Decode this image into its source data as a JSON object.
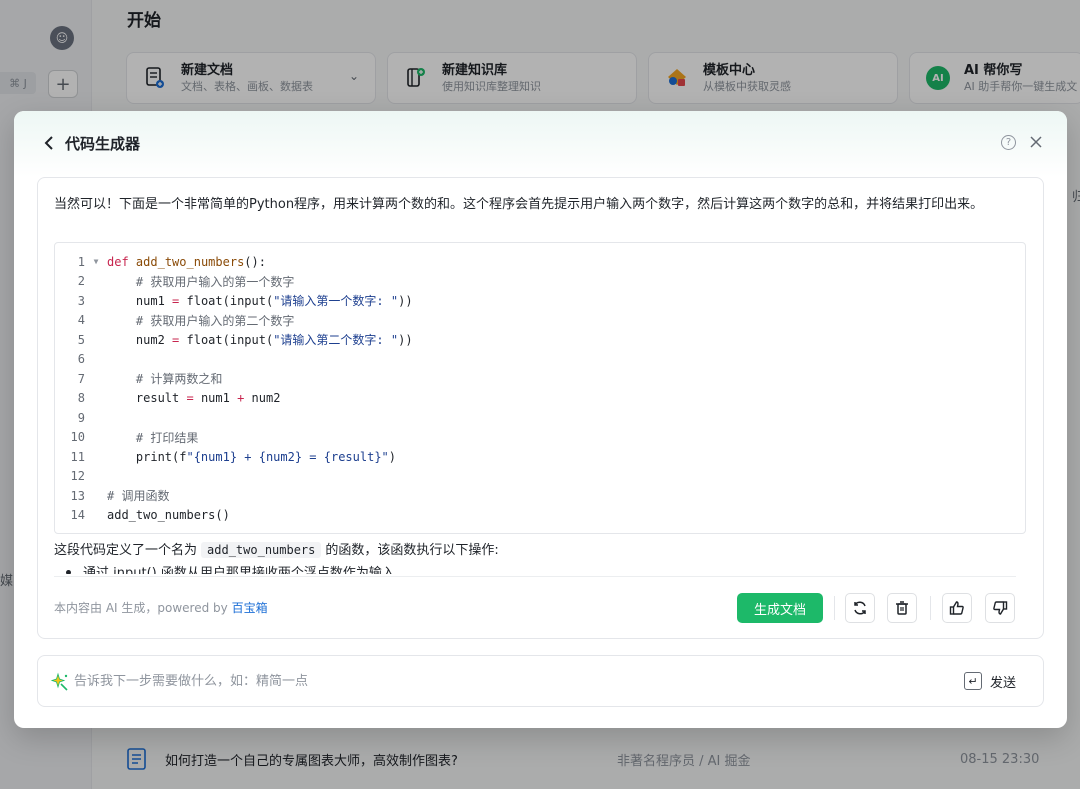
{
  "background": {
    "shortcut_hint": "⌘ J",
    "plus_label": "+",
    "side_fragment": "媒",
    "right_fragment": "归",
    "title": "开始",
    "quick_cards": [
      {
        "title": "新建文档",
        "subtitle": "文档、表格、画板、数据表",
        "icon": "new-doc-icon"
      },
      {
        "title": "新建知识库",
        "subtitle": "使用知识库整理知识",
        "icon": "new-knowledge-base-icon"
      },
      {
        "title": "模板中心",
        "subtitle": "从模板中获取灵感",
        "icon": "template-center-icon"
      },
      {
        "title": "AI 帮你写",
        "subtitle": "AI 助手帮你一键生成文",
        "icon": "ai-write-icon",
        "badge": "AI"
      }
    ],
    "doc_row": {
      "title": "如何打造一个自己的专属图表大师，高效制作图表?",
      "author": "非著名程序员 / AI 掘金",
      "time": "08-15 23:30"
    }
  },
  "modal": {
    "title": "代码生成器",
    "help_label": "?",
    "intro": "当然可以！下面是一个非常简单的Python程序，用来计算两个数的和。这个程序会首先提示用户输入两个数字，然后计算这两个数字的总和，并将结果打印出来。",
    "code_lines": [
      "def add_two_numbers():",
      "    # 获取用户输入的第一个数字",
      "    num1 = float(input(\"请输入第一个数字: \"))",
      "    # 获取用户输入的第二个数字",
      "    num2 = float(input(\"请输入第二个数字: \"))",
      "",
      "    # 计算两数之和",
      "    result = num1 + num2",
      "",
      "    # 打印结果",
      "    print(f\"{num1} + {num2} = {result}\")",
      "",
      "# 调用函数",
      "add_two_numbers()"
    ],
    "explain_prefix": "这段代码定义了一个名为",
    "explain_code": "add_two_numbers",
    "explain_suffix": "的函数，该函数执行以下操作:",
    "bullet_text": "通过 input() 函数从用户那里接收两个浮点数作为输入",
    "footer_prefix": "本内容由 AI 生成，powered by ",
    "footer_link": "百宝箱",
    "generate_doc_label": "生成文档",
    "prompt_placeholder": "告诉我下一步需要做什么，如：精简一点",
    "send_label": "发送"
  },
  "colors": {
    "accent_green": "#1db969",
    "link_blue": "#1d6fd6"
  }
}
